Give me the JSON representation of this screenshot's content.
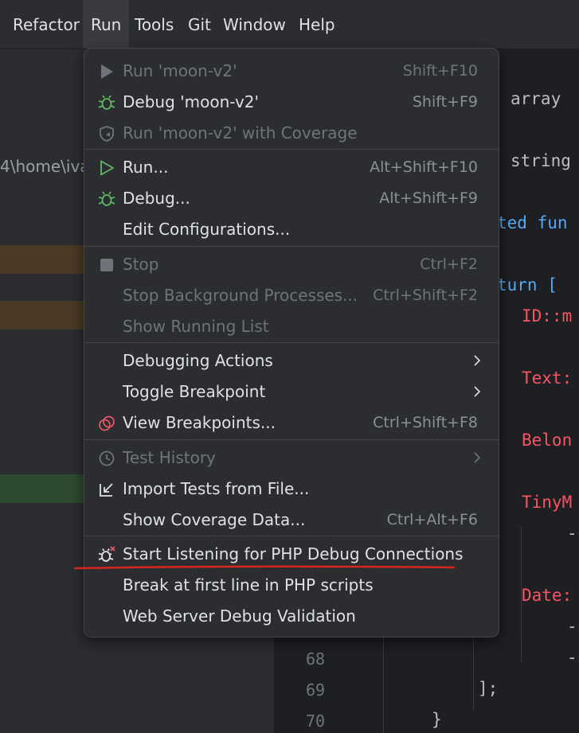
{
  "menubar": {
    "items": [
      {
        "label": "Refactor",
        "active": false
      },
      {
        "label": "Run",
        "active": true
      },
      {
        "label": "Tools",
        "active": false
      },
      {
        "label": "Git",
        "active": false
      },
      {
        "label": "Window",
        "active": false
      },
      {
        "label": "Help",
        "active": false
      }
    ]
  },
  "project": {
    "path_text": "4\\home\\iva"
  },
  "editor": {
    "lines": [
      {
        "text": "array",
        "color": "#bcbec4"
      },
      {
        "text": "string",
        "color": "#bcbec4"
      },
      {
        "text": "ted fun",
        "color": "#56a8f5"
      },
      {
        "text": "turn [",
        "color": "#56a8f5"
      },
      {
        "text": "ID::m",
        "color": "#f75464"
      },
      {
        "text": "Text:",
        "color": "#f75464"
      },
      {
        "text": "Belon",
        "color": "#f75464"
      },
      {
        "text": "TinyM",
        "color": "#f75464"
      },
      {
        "text": "-",
        "color": "#bcbec4"
      },
      {
        "text": "Date:",
        "color": "#f75464"
      },
      {
        "text": "-",
        "color": "#bcbec4"
      },
      {
        "text": "-",
        "color": "#bcbec4"
      },
      {
        "text": "];",
        "color": "#bcbec4"
      },
      {
        "text": "}",
        "color": "#bcbec4"
      }
    ],
    "line_numbers": [
      "68",
      "69",
      "70"
    ]
  },
  "run_menu": {
    "items": [
      {
        "label": "Run 'moon-v2'",
        "shortcut": "Shift+F10",
        "icon": "play-icon",
        "disabled": true
      },
      {
        "label": "Debug 'moon-v2'",
        "shortcut": "Shift+F9",
        "icon": "bug-icon",
        "disabled": false
      },
      {
        "label": "Run 'moon-v2' with Coverage",
        "shortcut": "",
        "icon": "coverage-shield-icon",
        "disabled": true
      },
      {
        "label": "Run...",
        "shortcut": "Alt+Shift+F10",
        "icon": "play-outline-icon",
        "disabled": false
      },
      {
        "label": "Debug...",
        "shortcut": "Alt+Shift+F9",
        "icon": "bug-icon",
        "disabled": false
      },
      {
        "label": "Edit Configurations...",
        "shortcut": "",
        "icon": "",
        "disabled": false
      },
      {
        "label": "Stop",
        "shortcut": "Ctrl+F2",
        "icon": "stop-icon",
        "disabled": true
      },
      {
        "label": "Stop Background Processes...",
        "shortcut": "Ctrl+Shift+F2",
        "icon": "",
        "disabled": true
      },
      {
        "label": "Show Running List",
        "shortcut": "",
        "icon": "",
        "disabled": true
      },
      {
        "label": "Debugging Actions",
        "shortcut": "",
        "icon": "",
        "disabled": false,
        "submenu": true
      },
      {
        "label": "Toggle Breakpoint",
        "shortcut": "",
        "icon": "",
        "disabled": false,
        "submenu": true
      },
      {
        "label": "View Breakpoints...",
        "shortcut": "Ctrl+Shift+F8",
        "icon": "breakpoints-icon",
        "disabled": false
      },
      {
        "label": "Test History",
        "shortcut": "",
        "icon": "history-clock-icon",
        "disabled": true,
        "submenu": true
      },
      {
        "label": "Import Tests from File...",
        "shortcut": "",
        "icon": "import-arrow-icon",
        "disabled": false
      },
      {
        "label": "Show Coverage Data...",
        "shortcut": "Ctrl+Alt+F6",
        "icon": "",
        "disabled": false
      },
      {
        "label": "Start Listening for PHP Debug Connections",
        "shortcut": "",
        "icon": "bug-listen-icon",
        "disabled": false
      },
      {
        "label": "Break at first line in PHP scripts",
        "shortcut": "",
        "icon": "",
        "disabled": false
      },
      {
        "label": "Web Server Debug Validation",
        "shortcut": "",
        "icon": "",
        "disabled": false
      }
    ]
  },
  "colors": {
    "accent_green": "#5fb865",
    "breakpoint_red": "#e55765",
    "annotation_red": "#d7261e",
    "highlight_orange": "#4a3a26",
    "highlight_green": "#2e4a30"
  }
}
